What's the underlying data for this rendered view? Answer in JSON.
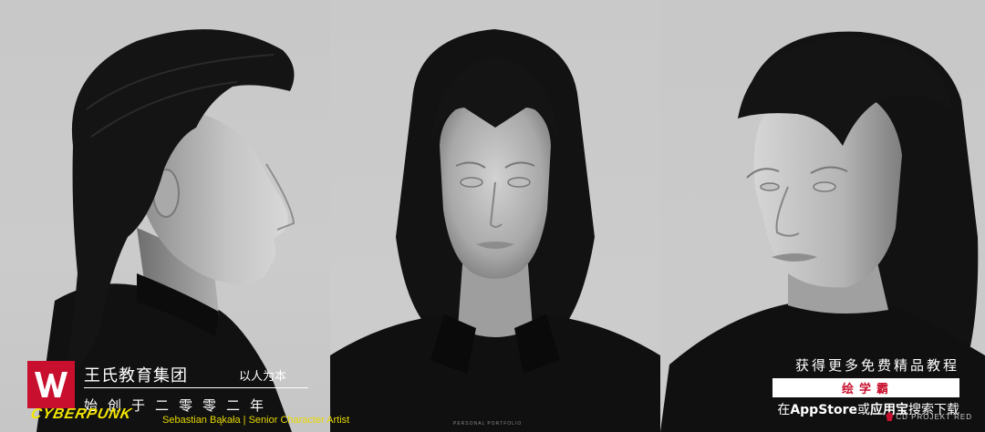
{
  "watermark": {
    "logo_letter": "W",
    "company_name": "王氏教育集团",
    "slogan": "以人为本",
    "founded": "始创于二零零二年",
    "brand_color": "#c8102e"
  },
  "game_logo": "CYBERPUNK",
  "artist_credit": "Sebastian Bąkała | Senior Character Artist",
  "portfolio_label": "PERSONAL PORTFOLIO",
  "promo": {
    "line1": "获得更多免费精品教程",
    "app_name": "绘学霸",
    "line3_prefix": "在",
    "line3_store": "AppStore",
    "line3_mid": "或",
    "line3_store2": "应用宝",
    "line3_suffix": "搜索下载"
  },
  "studio_logo": "CD PROJEKT RED",
  "colors": {
    "background": "#c9c9c9",
    "hair": "#141414",
    "skin": "#b9b9b9",
    "accent_yellow": "#f3e600"
  }
}
